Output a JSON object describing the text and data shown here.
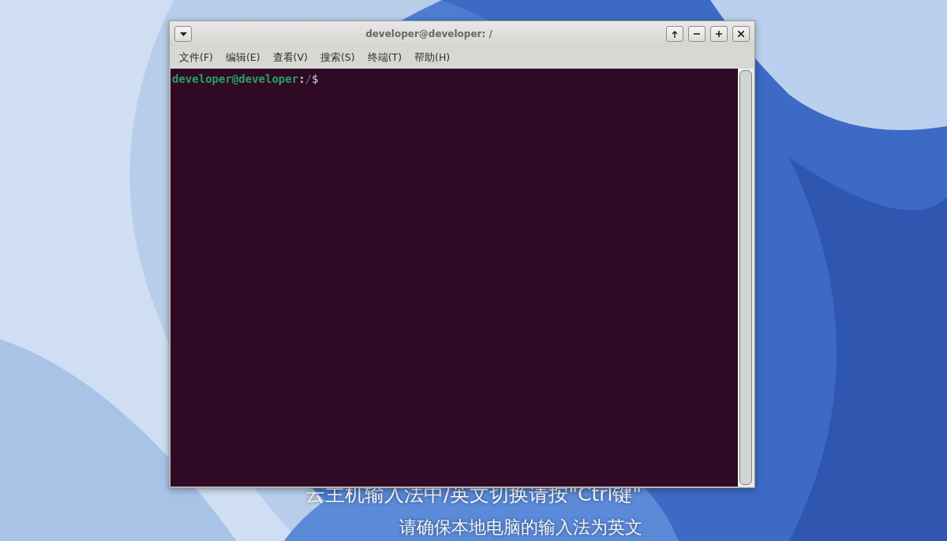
{
  "window": {
    "title": "developer@developer: /"
  },
  "menu": [
    {
      "label": "文件(F)"
    },
    {
      "label": "编辑(E)"
    },
    {
      "label": "查看(V)"
    },
    {
      "label": "搜索(S)"
    },
    {
      "label": "终端(T)"
    },
    {
      "label": "帮助(H)"
    }
  ],
  "terminal": {
    "user_host": "developer@developer",
    "separator": ":",
    "path": "/",
    "prompt": "$"
  },
  "overlay_hints": [
    "云主机输入法中/英文切换请按\"Ctrl键\"",
    "请确保本地电脑的输入法为英文"
  ]
}
